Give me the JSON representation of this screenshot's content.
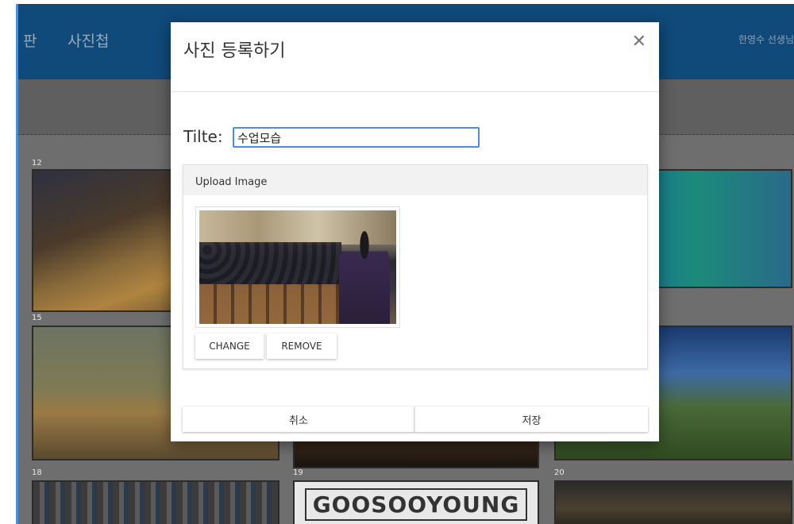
{
  "background_app": {
    "nav": [
      "판",
      "사진첩"
    ],
    "user_name": "한영수 선생님",
    "tiles": [
      {
        "number": "12"
      },
      {
        "number": "15"
      },
      {
        "number": "18"
      },
      {
        "number": "19",
        "logo_text": "GOOSOOYOUNG"
      },
      {
        "number": "20"
      }
    ]
  },
  "modal": {
    "title": "사진 등록하기",
    "close_icon": "close-icon",
    "title_field_label": "Tilte:",
    "title_field_value": "수업모습",
    "upload_card_label": "Upload Image",
    "change_label": "CHANGE",
    "remove_label": "REMOVE",
    "cancel_label": "취소",
    "save_label": "저장"
  },
  "colors": {
    "header_bg": "#0f4a7a",
    "input_focus_border": "#4a8fd9",
    "overlay": "#6e6e6e"
  }
}
